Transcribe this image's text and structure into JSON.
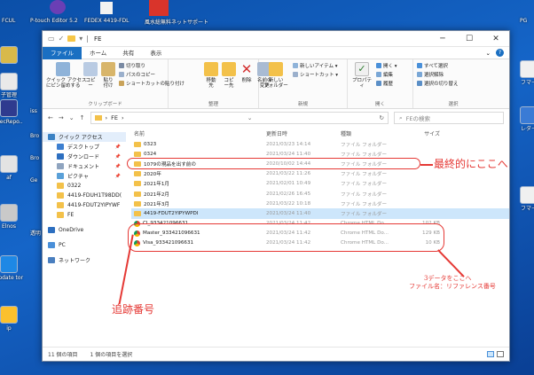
{
  "desktop": {
    "top_labels": [
      "FCUL",
      "P-touch Editor 5.2",
      "FEDEX 4419-FDL",
      "風水総無料ネットサポート",
      "PG"
    ],
    "left_icons": [
      {
        "label": "",
        "color": "#d8b94a"
      },
      {
        "label": "子管理",
        "color": "#e9e9e9"
      },
      {
        "label": "elecRepo..",
        "color": "#2f3b8f"
      },
      {
        "label": "af",
        "color": "#e3e3e3"
      },
      {
        "label": "Elnos",
        "color": "#c9c9c9"
      },
      {
        "label": "Update tor",
        "color": "#1e88e5"
      },
      {
        "label": "ip",
        "color": "#fbc02d"
      }
    ],
    "right_icons": [
      {
        "label": "フマー",
        "color": "#f0f0f0"
      },
      {
        "label": "レダー",
        "color": "#3a7bd5"
      },
      {
        "label": "フマー",
        "color": "#f0f0f0"
      }
    ],
    "left2_icons": [
      "iss",
      "Bro",
      "Bro",
      "Ge",
      "透明"
    ]
  },
  "window": {
    "title": "FE",
    "controls": [
      "─",
      "☐",
      "✕"
    ],
    "tabs": [
      "ファイル",
      "ホーム",
      "共有",
      "表示"
    ],
    "ribbon": {
      "clipboard": {
        "name": "クリップボード",
        "pin": "クイック アクセス\nにピン留めする",
        "copy": "コピー",
        "paste": "貼り付け",
        "cut": "切り取り",
        "copy_path": "パスのコピー",
        "paste_shortcut": "ショートカットの貼り付け"
      },
      "organize": {
        "name": "整理",
        "move_to": "移動先",
        "copy_to": "コピー先",
        "delete": "削除",
        "rename": "名前の\n変更"
      },
      "new": {
        "name": "新規",
        "new_folder": "新しい\nフォルダー",
        "new_item": "新しいアイテム ▾",
        "shortcut": "ショートカット ▾"
      },
      "open": {
        "name": "開く",
        "properties": "プロパティ",
        "open": "開く ▾",
        "edit": "編集",
        "history": "履歴"
      },
      "select": {
        "name": "選択",
        "select_all": "すべて選択",
        "select_none": "選択解除",
        "invert": "選択の切り替え"
      }
    },
    "address": {
      "path": "FE",
      "search_placeholder": "FEの検索"
    },
    "nav": [
      {
        "label": "クイック アクセス",
        "type": "quick",
        "color": "#3b82c4",
        "pin": ""
      },
      {
        "label": "デスクトップ",
        "type": "item",
        "color": "#3c7fd0",
        "pin": "📌"
      },
      {
        "label": "ダウンロード",
        "type": "item",
        "color": "#2d6fc0",
        "pin": "📌"
      },
      {
        "label": "ドキュメント",
        "type": "item",
        "color": "#8fa4bf",
        "pin": "📌"
      },
      {
        "label": "ピクチャ",
        "type": "item",
        "color": "#5aa0d8",
        "pin": "📌"
      },
      {
        "label": "0322",
        "type": "item",
        "color": "#f3c14a",
        "pin": ""
      },
      {
        "label": "4419-FDUH1T98DD(",
        "type": "item",
        "color": "#f3c14a",
        "pin": ""
      },
      {
        "label": "4419-FDUT2YIPYWF",
        "type": "item",
        "color": "#f3c14a",
        "pin": ""
      },
      {
        "label": "FE",
        "type": "item",
        "color": "#f3c14a",
        "pin": ""
      },
      {
        "label": "OneDrive",
        "type": "section",
        "color": "#2d6fc0",
        "pin": ""
      },
      {
        "label": "PC",
        "type": "section",
        "color": "#4a90d9",
        "pin": ""
      },
      {
        "label": "ネットワーク",
        "type": "section",
        "color": "#4a7fbf",
        "pin": ""
      }
    ],
    "columns": [
      "名前",
      "更新日時",
      "種類",
      "サイズ"
    ],
    "files": [
      {
        "name": "0323",
        "date": "2021/03/23 14:14",
        "type": "ファイル フォルダー",
        "size": "",
        "icon": "folder"
      },
      {
        "name": "0324",
        "date": "2021/03/24 11:40",
        "type": "ファイル フォルダー",
        "size": "",
        "icon": "folder"
      },
      {
        "name": "1079の現品を出す前の",
        "date": "2020/10/02 14:44",
        "type": "ファイル フォルダー",
        "size": "",
        "icon": "folder"
      },
      {
        "name": "2020年",
        "date": "2021/03/22 11:26",
        "type": "ファイル フォルダー",
        "size": "",
        "icon": "folder"
      },
      {
        "name": "2021年1月",
        "date": "2021/02/01 10:49",
        "type": "ファイル フォルダー",
        "size": "",
        "icon": "folder"
      },
      {
        "name": "2021年2月",
        "date": "2021/02/26 16:45",
        "type": "ファイル フォルダー",
        "size": "",
        "icon": "folder"
      },
      {
        "name": "2021年3月",
        "date": "2021/03/22 10:18",
        "type": "ファイル フォルダー",
        "size": "",
        "icon": "folder"
      },
      {
        "name": "4419-FDUT2YIPYWPDI",
        "date": "2021/03/24 11:40",
        "type": "ファイル フォルダー",
        "size": "",
        "icon": "folder",
        "selected": true
      },
      {
        "name": "CI_933421096631",
        "date": "2021/03/24 11:42",
        "type": "Chrome HTML Do...",
        "size": "102 KB",
        "icon": "chrome"
      },
      {
        "name": "Master_933421096631",
        "date": "2021/03/24 11:42",
        "type": "Chrome HTML Do...",
        "size": "129 KB",
        "icon": "chrome"
      },
      {
        "name": "Visa_933421096631",
        "date": "2021/03/24 11:42",
        "type": "Chrome HTML Do...",
        "size": "10 KB",
        "icon": "chrome"
      }
    ],
    "status": {
      "count": "11 個の項目",
      "selected": "1 個の項目を選択"
    }
  },
  "annotations": {
    "final_here": "最終的にここへ",
    "tracking_no": "追跡番号",
    "data_here_1": "3データをここへ",
    "data_here_2": "ファイル名：リファレンス番号",
    "color": "#e53935"
  }
}
